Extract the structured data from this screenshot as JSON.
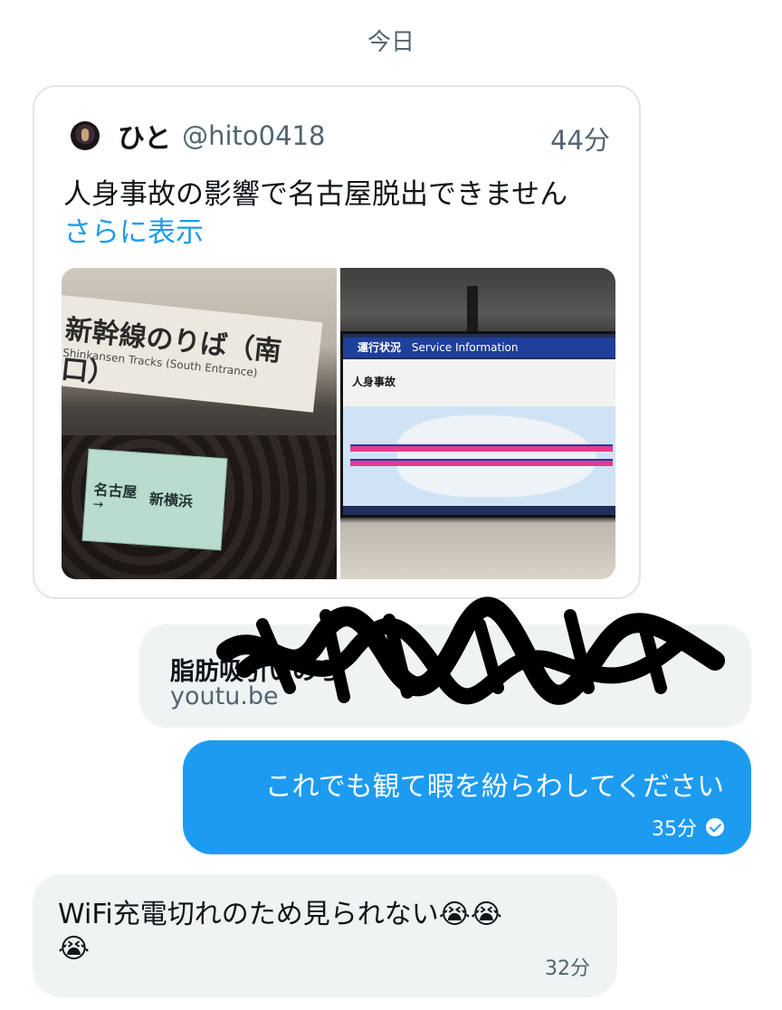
{
  "date_separator": "今日",
  "quoted_tweet": {
    "author_name": "ひと",
    "author_handle": "@hito0418",
    "time": "44分",
    "text": "人身事故の影響で名古屋脱出できません",
    "show_more": "さらに表示",
    "photo_1": {
      "sign_text": "新幹線のりば（南口）",
      "sign_sub": "Shinkansen Tracks (South Entrance)",
      "ticket_from": "名古屋",
      "ticket_to": "新横浜"
    },
    "photo_2": {
      "board_title": "運行状況",
      "board_title_en": "Service Information",
      "status_text": "人身事故"
    }
  },
  "link_message": {
    "title": "脂肪吸引いのち",
    "domain": "youtu.be"
  },
  "sent_message": {
    "text": "これでも観て暇を紛らわしてください",
    "time": "35分",
    "status_icon": "read-check-icon"
  },
  "received_message": {
    "text": "WiFi充電切れのため見られない",
    "emoji": "😭",
    "time": "32分"
  }
}
